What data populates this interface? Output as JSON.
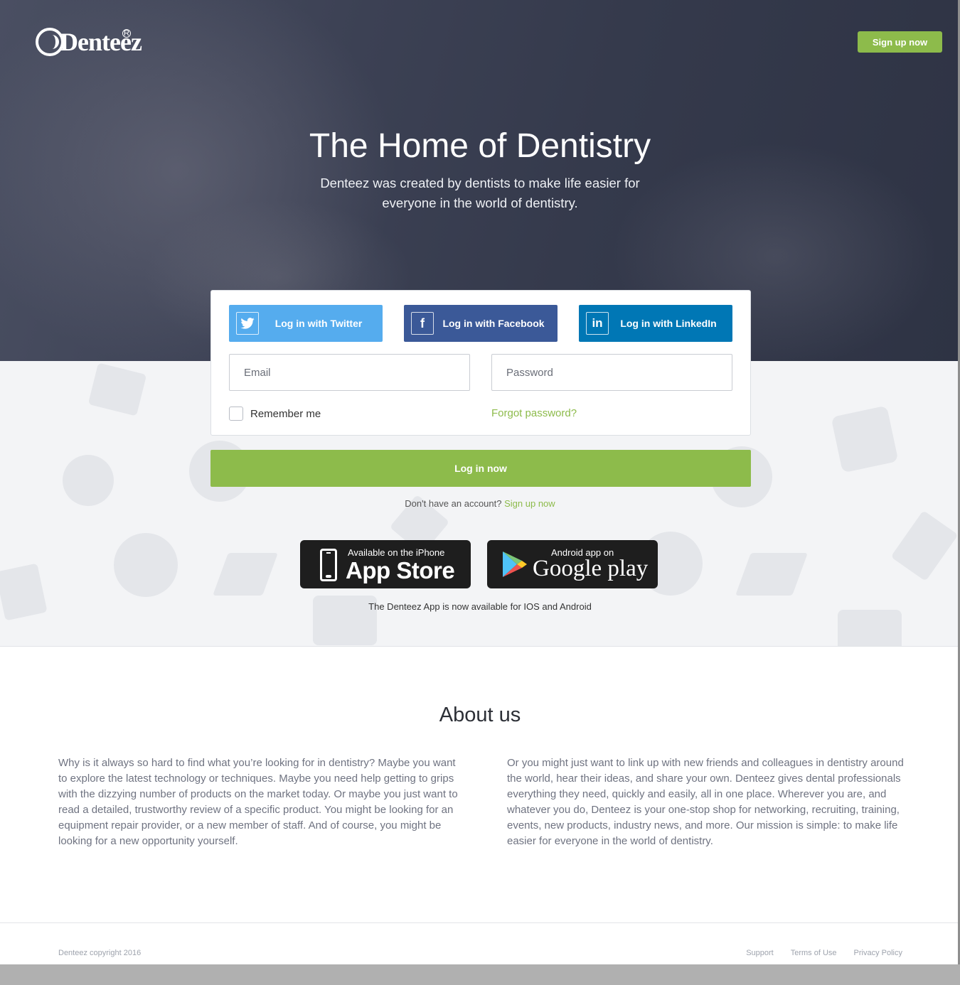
{
  "header": {
    "logo_text": "Denteez",
    "signup_label": "Sign up now"
  },
  "hero": {
    "title": "The Home of Dentistry",
    "subtitle": "Denteez was created by dentists to make life easier for everyone in the world of dentistry."
  },
  "login": {
    "twitter_label": "Log in with Twitter",
    "facebook_label": "Log in with Facebook",
    "linkedin_label": "Log in with LinkedIn",
    "email_placeholder": "Email",
    "password_placeholder": "Password",
    "remember_label": "Remember me",
    "forgot_label": "Forgot password?",
    "submit_label": "Log in now",
    "no_account_text": "Don't have an account?",
    "signup_link": "Sign up now"
  },
  "apps": {
    "appstore_small": "Available on the iPhone",
    "appstore_big": "App Store",
    "gplay_small": "Android app on",
    "gplay_big": "Google play",
    "note": "The Denteez App is now available for IOS and Android"
  },
  "about": {
    "title": "About us",
    "col1": "Why is it always so hard to find what you’re looking for in dentistry? Maybe you want to explore the latest technology or techniques. Maybe you need help getting to grips with the dizzying number of products on the market today. Or maybe you just want to read a detailed, trustworthy review of a specific product. You might be looking for an equipment repair provider, or a new member of staff. And of course, you might be looking for a new opportunity yourself.",
    "col2": "Or you might just want to link up with new friends and colleagues in dentistry around the world, hear their ideas, and share your own. Denteez gives dental professionals everything they need, quickly and easily, all in one place. Wherever you are, and whatever you do, Denteez is your one-stop shop for networking, recruiting, training, events, new products, industry news, and more. Our mission is simple: to make life easier for everyone in the world of dentistry."
  },
  "footer": {
    "copyright": "Denteez copyright 2016",
    "links": [
      "Support",
      "Terms of Use",
      "Privacy Policy"
    ]
  },
  "colors": {
    "accent_green": "#8dbb4b",
    "twitter": "#55acee",
    "facebook": "#3b5998",
    "linkedin": "#0077b5"
  },
  "icons": [
    "twitter-icon",
    "facebook-icon",
    "linkedin-icon",
    "phone-icon",
    "google-play-icon",
    "registered-icon"
  ]
}
